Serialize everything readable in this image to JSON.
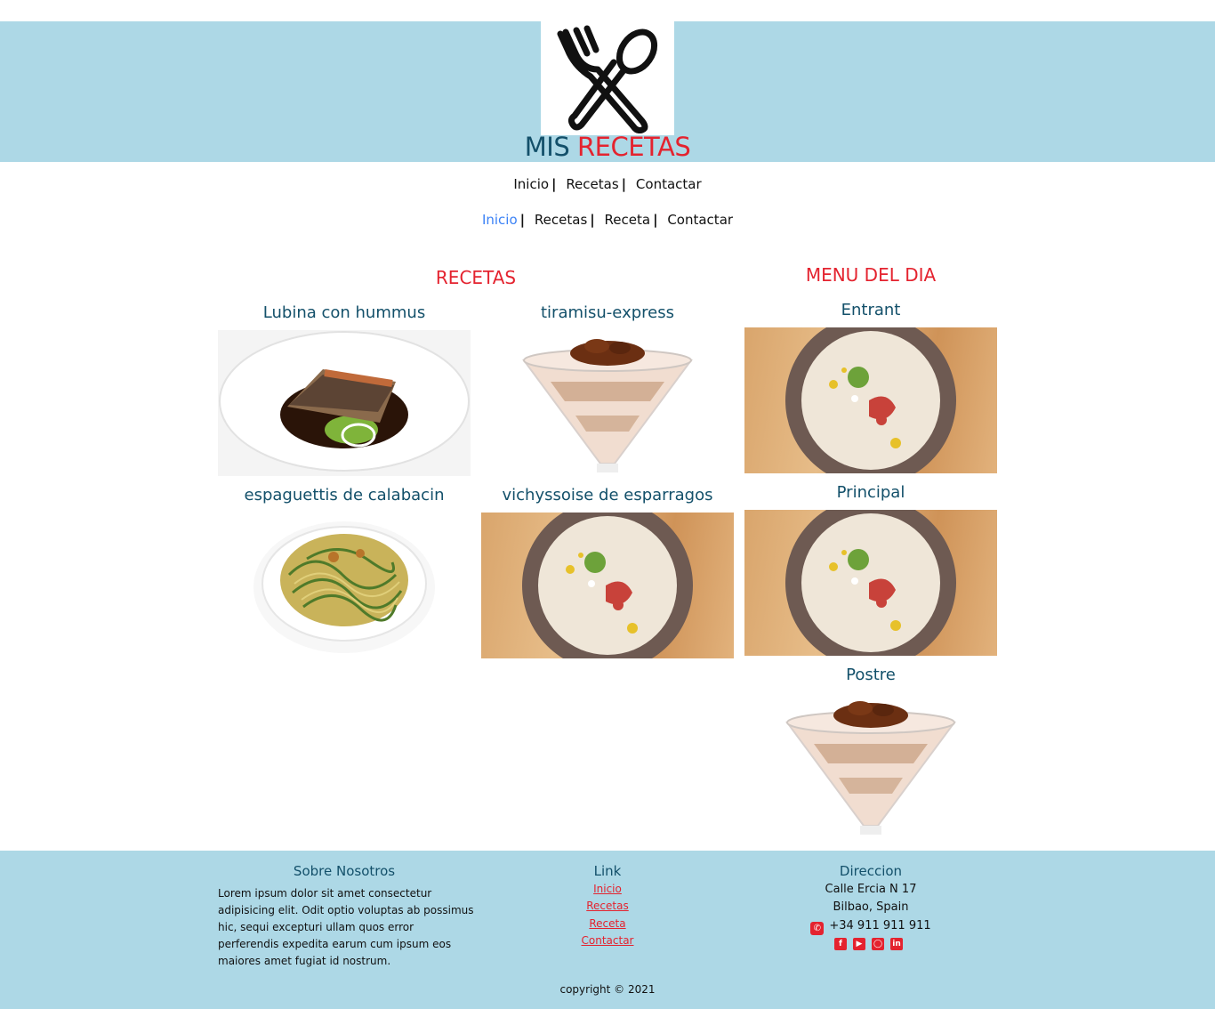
{
  "header": {
    "logo_icon": "fork-spoon-icon",
    "title_part1": "MIS",
    "title_part2": "RECETAS"
  },
  "nav_primary": {
    "items": [
      "Inicio",
      "Recetas",
      "Contactar"
    ],
    "separator": "|"
  },
  "nav_secondary": {
    "items": [
      "Inicio",
      "Recetas",
      "Receta",
      "Contactar"
    ],
    "active": "Inicio",
    "separator": "|"
  },
  "recetas": {
    "heading": "RECETAS",
    "items": [
      {
        "title": "Lubina con hummus",
        "image": "fish-dish"
      },
      {
        "title": "tiramisu-express",
        "image": "tiramisu-glass"
      },
      {
        "title": "espaguettis de calabacin",
        "image": "zucchini-noodles"
      },
      {
        "title": "vichyssoise de esparragos",
        "image": "cream-soup-bowl"
      }
    ]
  },
  "menu_del_dia": {
    "heading": "MENU DEL DIA",
    "items": [
      {
        "title": "Entrant",
        "image": "cream-soup-bowl"
      },
      {
        "title": "Principal",
        "image": "cream-soup-bowl"
      },
      {
        "title": "Postre",
        "image": "tiramisu-glass"
      }
    ]
  },
  "footer": {
    "about_title": "Sobre Nosotros",
    "about_text": "Lorem ipsum dolor sit amet consectetur adipisicing elit. Odit optio voluptas ab possimus hic, sequi excepturi ullam quos error perferendis expedita earum cum ipsum eos maiores amet fugiat id nostrum.",
    "links_title": "Link",
    "links": [
      "Inicio",
      "Recetas",
      "Receta",
      "Contactar"
    ],
    "address_title": "Direccion",
    "address_line1": "Calle Ercia N 17",
    "address_line2": "Bilbao, Spain",
    "phone": "+34 911 911 911",
    "social_icons": [
      "facebook-icon",
      "youtube-icon",
      "instagram-icon",
      "linkedin-icon"
    ],
    "copyright": "copyright © 2021"
  },
  "colors": {
    "band": "#add8e6",
    "accent_red": "#e4232f",
    "dark_teal": "#13506a",
    "active_link": "#3b82f6"
  }
}
